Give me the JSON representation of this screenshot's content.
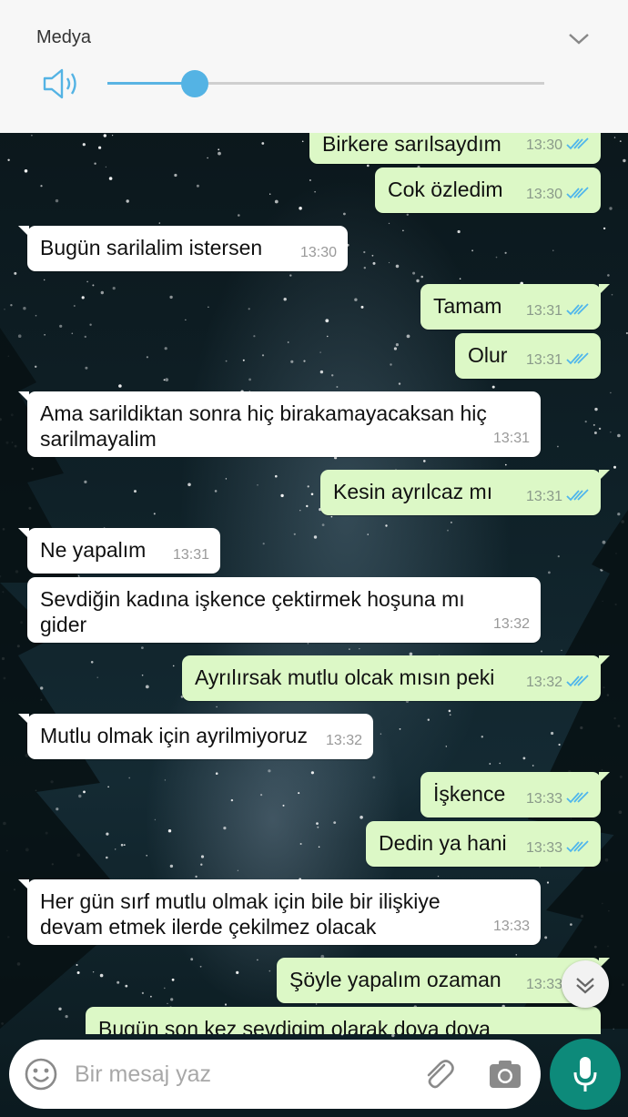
{
  "volume": {
    "title": "Medya",
    "level": 0.2
  },
  "messages": [
    {
      "dir": "out",
      "text": "Birkere sarılsaydım",
      "time": "13:30"
    },
    {
      "dir": "out",
      "text": "Cok özledim",
      "time": "13:30"
    },
    {
      "dir": "in",
      "text": "Bugün sarilalim istersen",
      "time": "13:30"
    },
    {
      "dir": "out",
      "text": "Tamam",
      "time": "13:31"
    },
    {
      "dir": "out",
      "text": "Olur",
      "time": "13:31"
    },
    {
      "dir": "in",
      "text_lines": [
        "Ama sarildiktan sonra hiç birakamayacaksan hiç",
        "sarilmayalim"
      ],
      "time": "13:31"
    },
    {
      "dir": "out",
      "text": "Kesin ayrılcaz mı",
      "time": "13:31"
    },
    {
      "dir": "in",
      "text": "Ne yapalım",
      "time": "13:31"
    },
    {
      "dir": "in",
      "text_lines": [
        "Sevdiğin kadına işkence çektirmek hoşuna mı",
        "gider"
      ],
      "time": "13:32"
    },
    {
      "dir": "out",
      "text": "Ayrılırsak mutlu olcak mısın peki",
      "time": "13:32"
    },
    {
      "dir": "in",
      "text": "Mutlu olmak için ayrilmiyoruz",
      "time": "13:32"
    },
    {
      "dir": "out",
      "text": "İşkence",
      "time": "13:33"
    },
    {
      "dir": "out",
      "text": "Dedin ya hani",
      "time": "13:33"
    },
    {
      "dir": "in",
      "text_lines": [
        "Her gün sırf mutlu olmak için bile bir ilişkiye",
        "devam etmek ilerde çekilmez olacak"
      ],
      "time": "13:33"
    },
    {
      "dir": "out",
      "text": "Şöyle yapalım ozaman",
      "time": "13:33"
    },
    {
      "dir": "out",
      "text": "Bugün son kez sevdigim olarak doya doya"
    }
  ],
  "input": {
    "placeholder": "Bir mesaj yaz"
  },
  "colors": {
    "incoming": "#ffffff",
    "outgoing": "#dcf8c6",
    "read_ticks": "#4fb6ec",
    "accent": "#0d8a7a",
    "slider": "#54b3e4"
  },
  "icons": [
    "chevron-down-icon",
    "speaker-icon",
    "double-check-icon",
    "scroll-down-icon",
    "emoji-icon",
    "attach-icon",
    "camera-icon",
    "mic-icon"
  ]
}
